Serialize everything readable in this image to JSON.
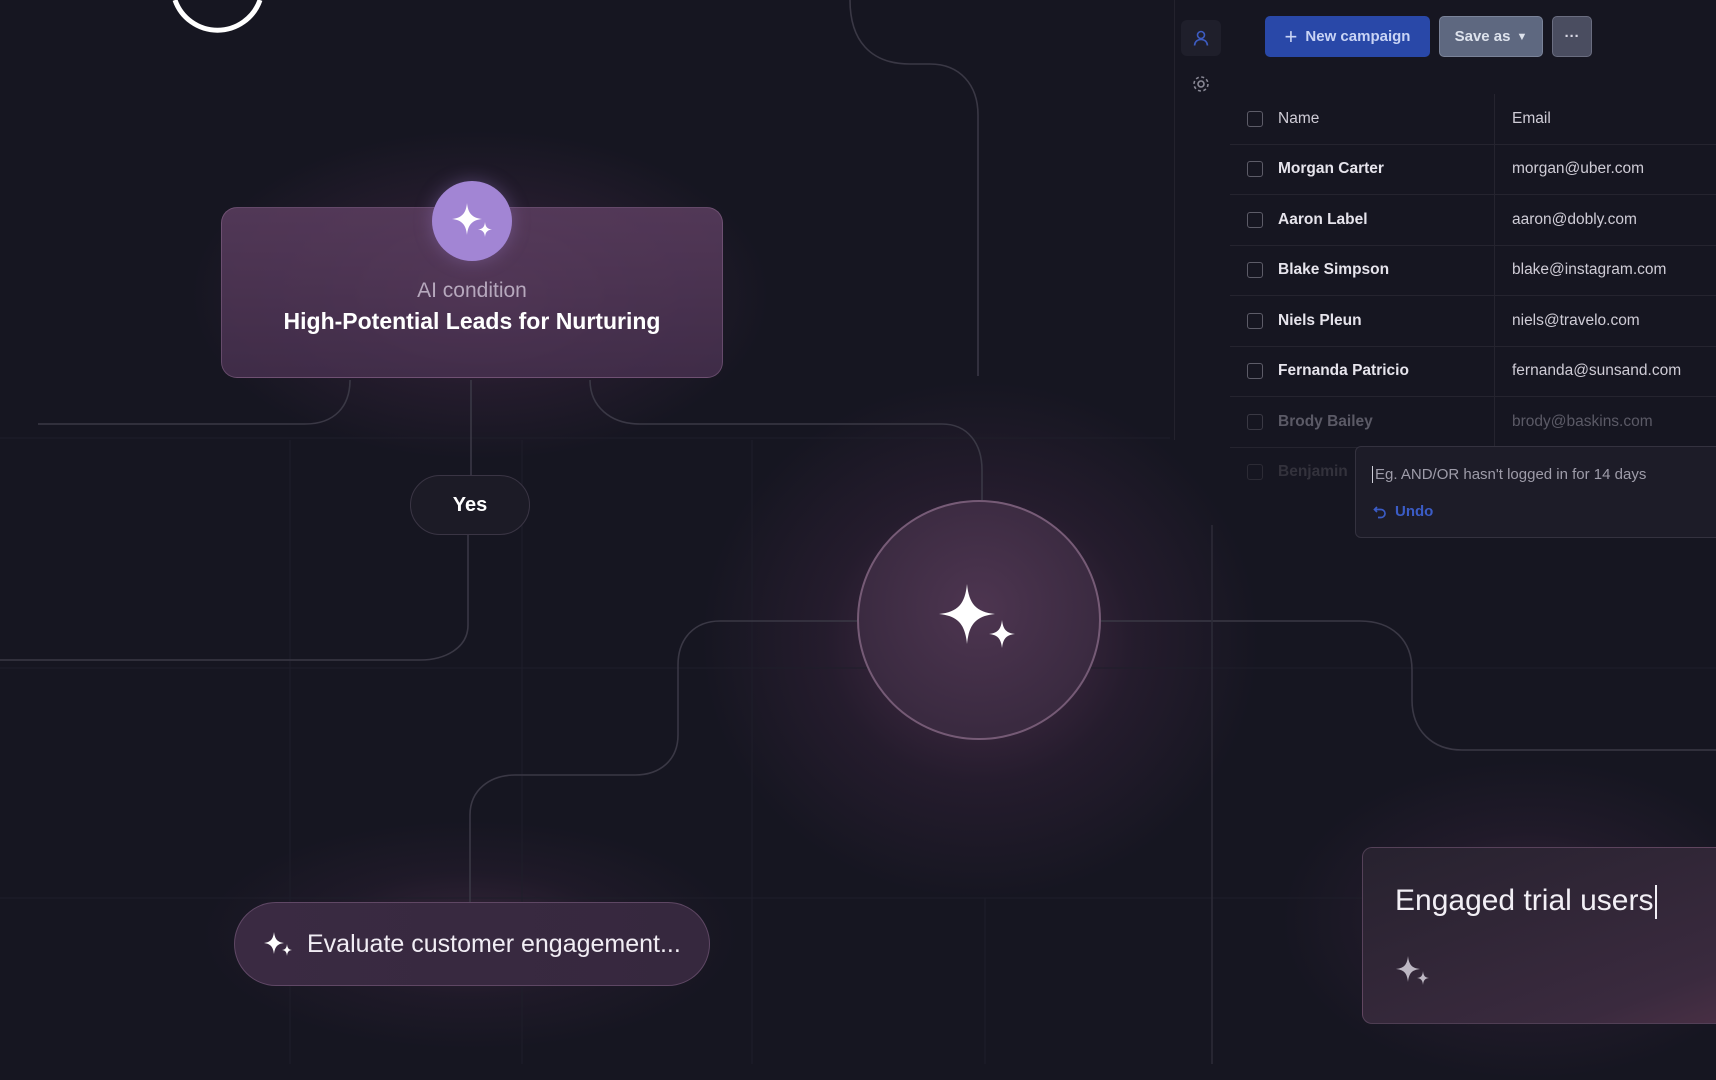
{
  "canvas": {
    "condition_node": {
      "subtitle": "AI condition",
      "title": "High-Potential Leads for Nurturing",
      "icon": "sparkles-icon",
      "badge_color": "#a285d4"
    },
    "branch_label": "Yes",
    "center_node": {
      "icon": "sparkles-icon"
    },
    "evaluate_node": {
      "icon": "sparkles-icon",
      "label": "Evaluate customer engagement..."
    }
  },
  "sidebar": {
    "icons": [
      "user-icon",
      "gear-icon"
    ]
  },
  "toolbar": {
    "new_campaign_label": "New campaign",
    "save_as_label": "Save as",
    "more_label": "···",
    "accent_color": "#2948a8"
  },
  "table": {
    "columns": [
      "Name",
      "Email"
    ],
    "rows": [
      {
        "name": "Morgan Carter",
        "email": "morgan@uber.com"
      },
      {
        "name": "Aaron Label",
        "email": "aaron@dobly.com"
      },
      {
        "name": "Blake Simpson",
        "email": "blake@instagram.com"
      },
      {
        "name": "Niels Pleun",
        "email": "niels@travelo.com"
      },
      {
        "name": "Fernanda Patricio",
        "email": "fernanda@sunsand.com"
      },
      {
        "name": "Brody Bailey",
        "email": "brody@baskins.com"
      },
      {
        "name": "Benjamin",
        "email": ""
      }
    ]
  },
  "filter": {
    "placeholder": "Eg. AND/OR hasn't logged in for 14 days",
    "undo_label": "Undo"
  },
  "prompt_card": {
    "text": "Engaged trial users",
    "icon": "sparkles-icon"
  }
}
